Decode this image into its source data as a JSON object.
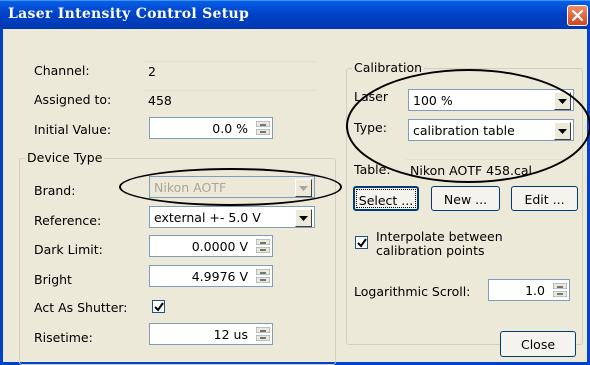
{
  "window": {
    "title": "Laser Intensity Control Setup"
  },
  "left": {
    "channel_label": "Channel:",
    "channel_value": "2",
    "assigned_label": "Assigned to:",
    "assigned_value": "458",
    "initial_label": "Initial Value:",
    "initial_value": "0.0 %"
  },
  "device_type": {
    "title": "Device Type",
    "brand_label": "Brand:",
    "brand_value": "Nikon AOTF",
    "reference_label": "Reference:",
    "reference_value": "external +- 5.0 V",
    "dark_label": "Dark Limit:",
    "dark_value": "0.0000 V",
    "bright_label": "Bright",
    "bright_value": "4.9976 V",
    "shutter_label": "Act As Shutter:",
    "shutter_checked": true,
    "rise_label": "Risetime:",
    "rise_value": "12 us"
  },
  "calibration": {
    "title": "Calibration",
    "laser_label": "Laser",
    "laser_value": "100 %",
    "type_label": "Type:",
    "type_value": "calibration table",
    "table_label": "Table:",
    "table_value": "Nikon AOTF 458.cal",
    "select_label": "Select ...",
    "new_label": "New ...",
    "edit_label": "Edit ...",
    "interpolate_label_1": "Interpolate between",
    "interpolate_label_2": "calibration points",
    "interpolate_checked": true,
    "log_label": "Logarithmic Scroll:",
    "log_value": "1.0"
  },
  "footer": {
    "close_label": "Close"
  }
}
